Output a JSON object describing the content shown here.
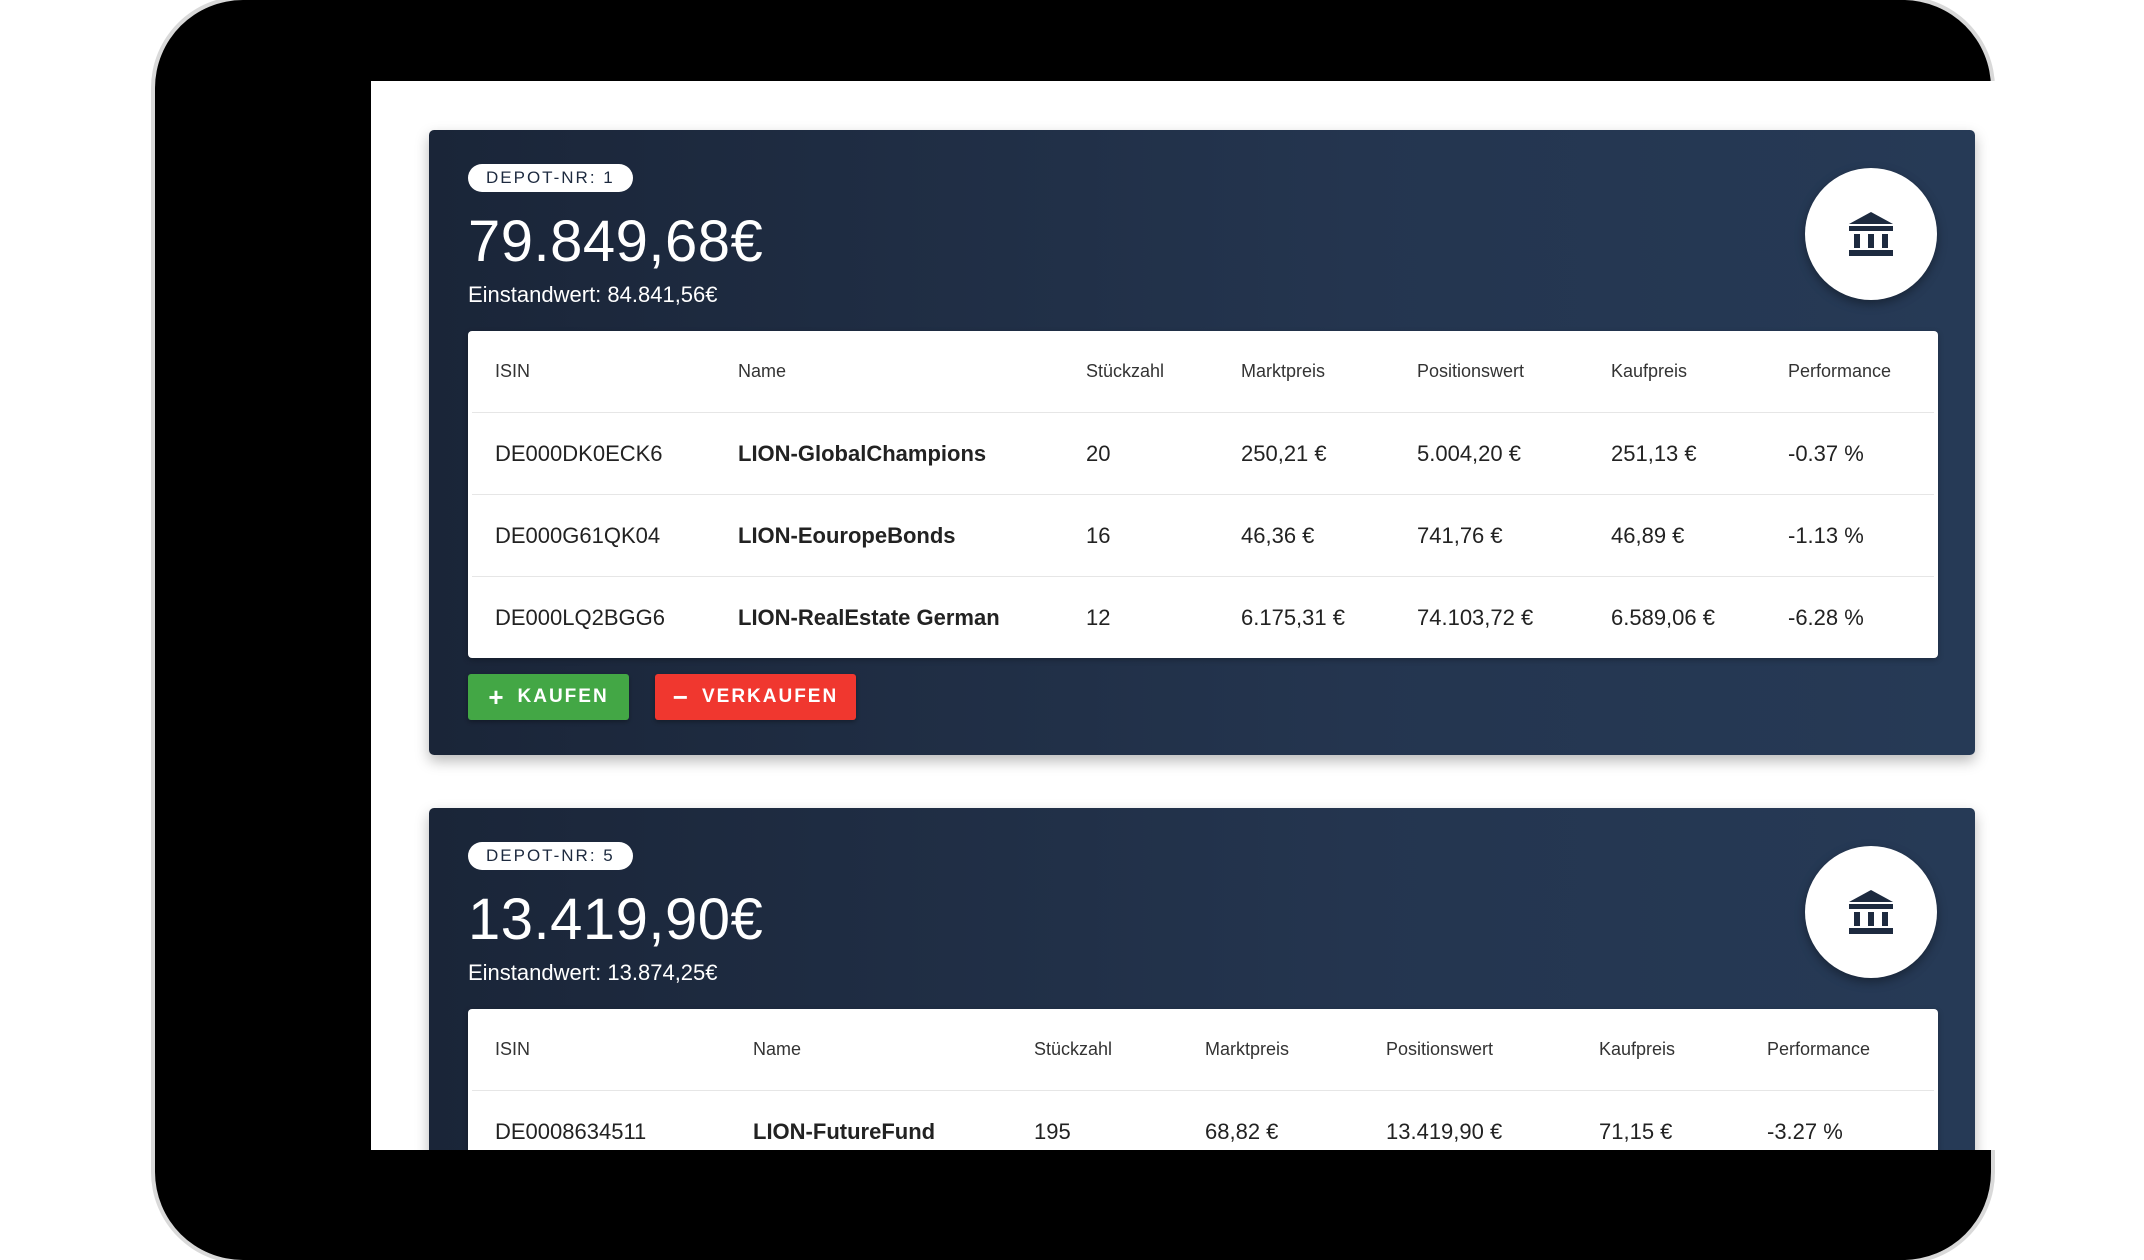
{
  "depots": [
    {
      "badge": "DEPOT-NR: 1",
      "amount": "79.849,68€",
      "invested": "Einstandwert: 84.841,56€",
      "icon": "bank-icon",
      "headers": [
        "ISIN",
        "Name",
        "Stückzahl",
        "Marktpreis",
        "Positionswert",
        "Kaufpreis",
        "Performance"
      ],
      "rows": [
        [
          "DE000DK0ECK6",
          "LION-GlobalChampions",
          "20",
          "250,21 €",
          "5.004,20 €",
          "251,13 €",
          "-0.37 %"
        ],
        [
          "DE000G61QK04",
          "LION-EouropeBonds",
          "16",
          "46,36 €",
          "741,76 €",
          "46,89 €",
          "-1.13 %"
        ],
        [
          "DE000LQ2BGG6",
          "LION-RealEstate German",
          "12",
          "6.175,31 €",
          "74.103,72 €",
          "6.589,06 €",
          "-6.28 %"
        ]
      ],
      "buy_label": "KAUFEN",
      "sell_label": "VERKAUFEN"
    },
    {
      "badge": "DEPOT-NR: 5",
      "amount": "13.419,90€",
      "invested": "Einstandwert: 13.874,25€",
      "icon": "bank-icon",
      "headers": [
        "ISIN",
        "Name",
        "Stückzahl",
        "Marktpreis",
        "Positionswert",
        "Kaufpreis",
        "Performance"
      ],
      "rows": [
        [
          "DE0008634511",
          "LION-FutureFund",
          "195",
          "68,82 €",
          "13.419,90 €",
          "71,15 €",
          "-3.27 %"
        ]
      ]
    }
  ],
  "colors": {
    "card_bg": "#1f2d44",
    "buy": "#43a745",
    "sell": "#f0372f"
  }
}
